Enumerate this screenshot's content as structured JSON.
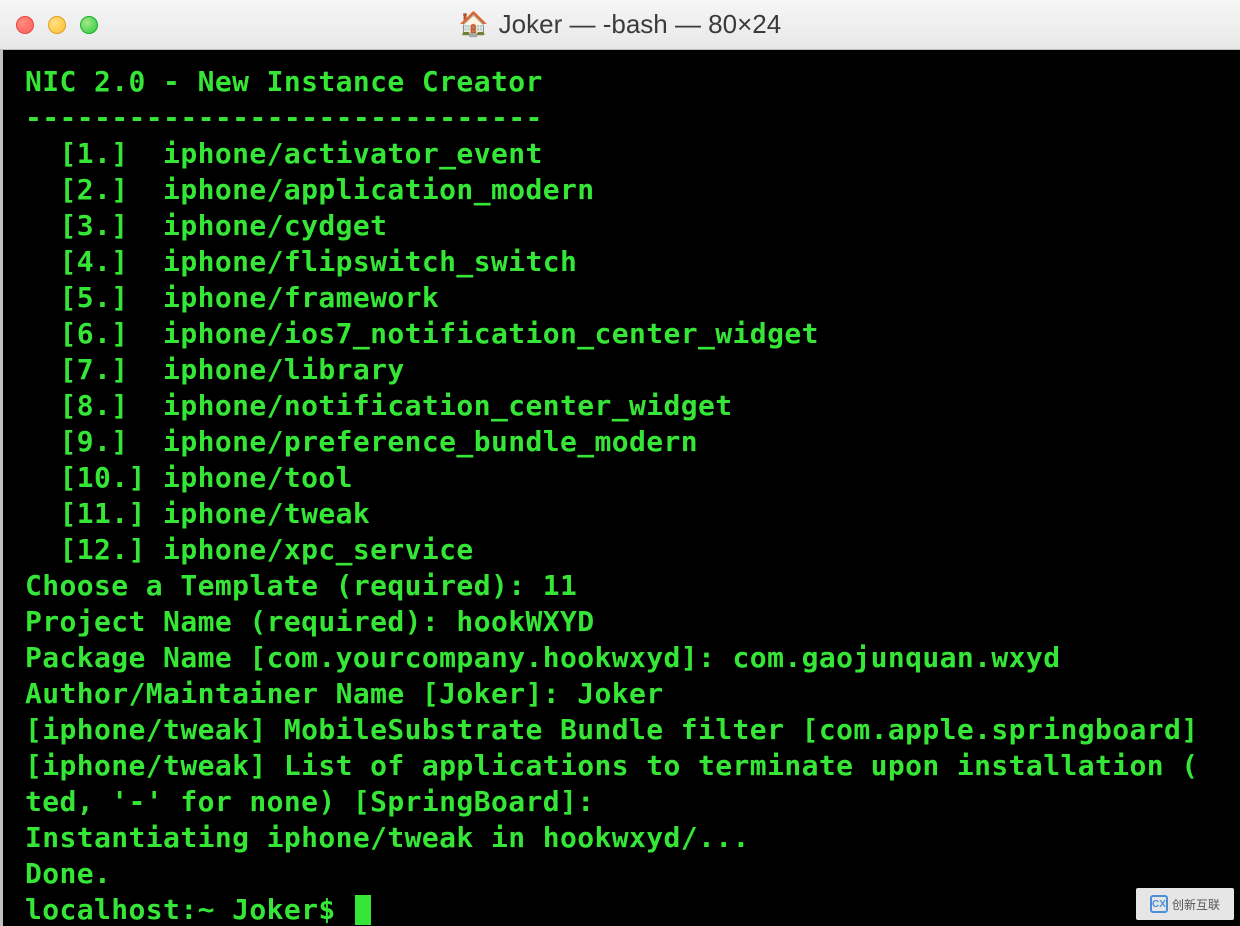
{
  "titlebar": {
    "home_icon": "🏠",
    "title": "Joker — -bash — 80×24"
  },
  "terminal": {
    "header": "NIC 2.0 - New Instance Creator",
    "divider": "------------------------------",
    "options": [
      "  [1.]  iphone/activator_event",
      "  [2.]  iphone/application_modern",
      "  [3.]  iphone/cydget",
      "  [4.]  iphone/flipswitch_switch",
      "  [5.]  iphone/framework",
      "  [6.]  iphone/ios7_notification_center_widget",
      "  [7.]  iphone/library",
      "  [8.]  iphone/notification_center_widget",
      "  [9.]  iphone/preference_bundle_modern",
      "  [10.] iphone/tool",
      "  [11.] iphone/tweak",
      "  [12.] iphone/xpc_service"
    ],
    "prompts": [
      "Choose a Template (required): 11",
      "Project Name (required): hookWXYD",
      "Package Name [com.yourcompany.hookwxyd]: com.gaojunquan.wxyd",
      "Author/Maintainer Name [Joker]: Joker",
      "[iphone/tweak] MobileSubstrate Bundle filter [com.apple.springboard]",
      "[iphone/tweak] List of applications to terminate upon installation (",
      "ted, '-' for none) [SpringBoard]:",
      "Instantiating iphone/tweak in hookwxyd/...",
      "Done."
    ],
    "prompt_line": "localhost:~ Joker$ "
  },
  "watermark": {
    "logo": "CX",
    "text": "创新互联"
  }
}
